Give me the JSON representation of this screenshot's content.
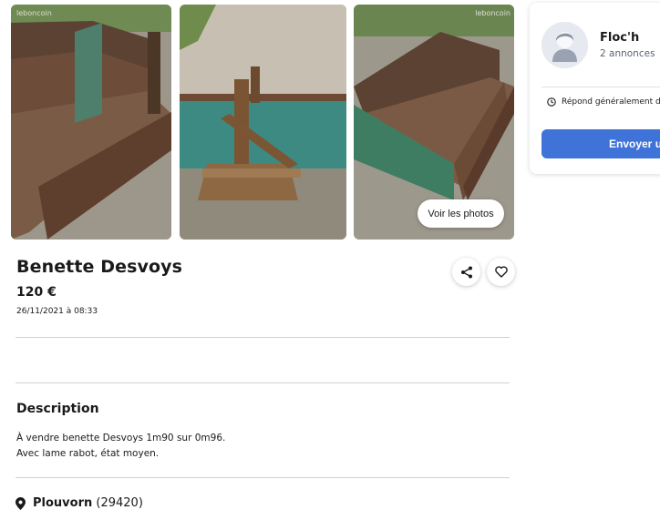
{
  "gallery": {
    "photos": [
      {
        "alt": "benette-photo-1",
        "watermark": "leboncoin"
      },
      {
        "alt": "benette-photo-2",
        "watermark": ""
      },
      {
        "alt": "benette-photo-3",
        "watermark": "leboncoin"
      }
    ],
    "see_photos_label": "Voir les photos"
  },
  "ad": {
    "title": "Benette Desvoys",
    "price": "120 €",
    "date": "26/11/2021 à 08:33"
  },
  "actions": {
    "share_icon": "share-icon",
    "favorite_icon": "heart-icon"
  },
  "description": {
    "heading": "Description",
    "lines": [
      "À vendre benette Desvoys 1m90 sur 0m96.",
      "Avec lame rabot, état moyen."
    ]
  },
  "location": {
    "icon": "map-pin-icon",
    "city": "Plouvorn",
    "zip": "(29420)"
  },
  "seller": {
    "name": "Floc'h",
    "ads_count": "2 annonces",
    "response_text": "Répond généralement dans",
    "send_button": "Envoyer un message"
  },
  "colors": {
    "accent": "#3f73d8",
    "separator": "#cfd3d9"
  }
}
